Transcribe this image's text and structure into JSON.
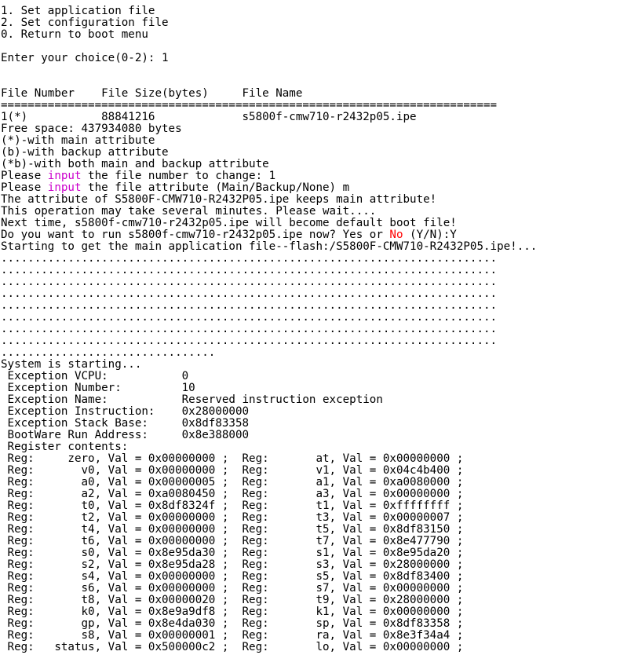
{
  "terminal": {
    "text_color": "#000000",
    "background_color": "#ffffff",
    "highlight_input_color": "#cc00cc",
    "highlight_no_color": "#ff0000",
    "lines": [
      {
        "segments": [
          {
            "text": "1. Set application file"
          }
        ]
      },
      {
        "segments": [
          {
            "text": "2. Set configuration file"
          }
        ]
      },
      {
        "segments": [
          {
            "text": "0. Return to boot menu"
          }
        ]
      },
      {
        "segments": [
          {
            "text": ""
          }
        ]
      },
      {
        "segments": [
          {
            "text": "Enter your choice(0-2): 1"
          }
        ]
      },
      {
        "segments": [
          {
            "text": ""
          }
        ]
      },
      {
        "segments": [
          {
            "text": ""
          }
        ]
      },
      {
        "segments": [
          {
            "text": "File Number    File Size(bytes)     File Name"
          }
        ]
      },
      {
        "segments": [
          {
            "text": "=========================================================================="
          }
        ]
      },
      {
        "segments": [
          {
            "text": "1(*)           88841216             s5800f-cmw710-r2432p05.ipe"
          }
        ]
      },
      {
        "segments": [
          {
            "text": "Free space: 437934080 bytes"
          }
        ]
      },
      {
        "segments": [
          {
            "text": "(*)-with main attribute"
          }
        ]
      },
      {
        "segments": [
          {
            "text": "(b)-with backup attribute"
          }
        ]
      },
      {
        "segments": [
          {
            "text": "(*b)-with both main and backup attribute"
          }
        ]
      },
      {
        "segments": [
          {
            "text": "Please "
          },
          {
            "text": "input",
            "style": "hl-input"
          },
          {
            "text": " the file number to change: 1"
          }
        ]
      },
      {
        "segments": [
          {
            "text": "Please "
          },
          {
            "text": "input",
            "style": "hl-input"
          },
          {
            "text": " the file attribute (Main/Backup/None) m"
          }
        ]
      },
      {
        "segments": [
          {
            "text": "The attribute of S5800F-CMW710-R2432P05.ipe keeps main attribute!"
          }
        ]
      },
      {
        "segments": [
          {
            "text": "This operation may take several minutes. Please wait...."
          }
        ]
      },
      {
        "segments": [
          {
            "text": "Next time, s5800f-cmw710-r2432p05.ipe will become default boot file!"
          }
        ]
      },
      {
        "segments": [
          {
            "text": "Do you want to run s5800f-cmw710-r2432p05.ipe now? Yes or "
          },
          {
            "text": "No",
            "style": "hl-no"
          },
          {
            "text": " (Y/N):Y"
          }
        ]
      },
      {
        "segments": [
          {
            "text": "Starting to get the main application file--flash:/S5800F-CMW710-R2432P05.ipe!..."
          }
        ]
      },
      {
        "segments": [
          {
            "text": ".........................................................................."
          }
        ]
      },
      {
        "segments": [
          {
            "text": ".........................................................................."
          }
        ]
      },
      {
        "segments": [
          {
            "text": ".........................................................................."
          }
        ]
      },
      {
        "segments": [
          {
            "text": ".........................................................................."
          }
        ]
      },
      {
        "segments": [
          {
            "text": ".........................................................................."
          }
        ]
      },
      {
        "segments": [
          {
            "text": ".........................................................................."
          }
        ]
      },
      {
        "segments": [
          {
            "text": ".........................................................................."
          }
        ]
      },
      {
        "segments": [
          {
            "text": ".........................................................................."
          }
        ]
      },
      {
        "segments": [
          {
            "text": "................................"
          }
        ]
      },
      {
        "segments": [
          {
            "text": "System is starting..."
          }
        ]
      },
      {
        "segments": [
          {
            "text": " Exception VCPU:           0"
          }
        ]
      },
      {
        "segments": [
          {
            "text": " Exception Number:         10"
          }
        ]
      },
      {
        "segments": [
          {
            "text": " Exception Name:           Reserved instruction exception"
          }
        ]
      },
      {
        "segments": [
          {
            "text": " Exception Instruction:    0x28000000"
          }
        ]
      },
      {
        "segments": [
          {
            "text": " Exception Stack Base:     0x8df83358"
          }
        ]
      },
      {
        "segments": [
          {
            "text": " BootWare Run Address:     0x8e388000"
          }
        ]
      },
      {
        "segments": [
          {
            "text": " Register contents:"
          }
        ]
      },
      {
        "segments": [
          {
            "text": " Reg:     zero, Val = 0x00000000 ;  Reg:       at, Val = 0x00000000 ;"
          }
        ]
      },
      {
        "segments": [
          {
            "text": " Reg:       v0, Val = 0x00000000 ;  Reg:       v1, Val = 0x04c4b400 ;"
          }
        ]
      },
      {
        "segments": [
          {
            "text": " Reg:       a0, Val = 0x00000005 ;  Reg:       a1, Val = 0xa0080000 ;"
          }
        ]
      },
      {
        "segments": [
          {
            "text": " Reg:       a2, Val = 0xa0080450 ;  Reg:       a3, Val = 0x00000000 ;"
          }
        ]
      },
      {
        "segments": [
          {
            "text": " Reg:       t0, Val = 0x8df8324f ;  Reg:       t1, Val = 0xffffffff ;"
          }
        ]
      },
      {
        "segments": [
          {
            "text": " Reg:       t2, Val = 0x00000000 ;  Reg:       t3, Val = 0x00000007 ;"
          }
        ]
      },
      {
        "segments": [
          {
            "text": " Reg:       t4, Val = 0x00000000 ;  Reg:       t5, Val = 0x8df83150 ;"
          }
        ]
      },
      {
        "segments": [
          {
            "text": " Reg:       t6, Val = 0x00000000 ;  Reg:       t7, Val = 0x8e477790 ;"
          }
        ]
      },
      {
        "segments": [
          {
            "text": " Reg:       s0, Val = 0x8e95da30 ;  Reg:       s1, Val = 0x8e95da20 ;"
          }
        ]
      },
      {
        "segments": [
          {
            "text": " Reg:       s2, Val = 0x8e95da28 ;  Reg:       s3, Val = 0x28000000 ;"
          }
        ]
      },
      {
        "segments": [
          {
            "text": " Reg:       s4, Val = 0x00000000 ;  Reg:       s5, Val = 0x8df83400 ;"
          }
        ]
      },
      {
        "segments": [
          {
            "text": " Reg:       s6, Val = 0x00000000 ;  Reg:       s7, Val = 0x00000000 ;"
          }
        ]
      },
      {
        "segments": [
          {
            "text": " Reg:       t8, Val = 0x00000020 ;  Reg:       t9, Val = 0x28000000 ;"
          }
        ]
      },
      {
        "segments": [
          {
            "text": " Reg:       k0, Val = 0x8e9a9df8 ;  Reg:       k1, Val = 0x00000000 ;"
          }
        ]
      },
      {
        "segments": [
          {
            "text": " Reg:       gp, Val = 0x8e4da030 ;  Reg:       sp, Val = 0x8df83358 ;"
          }
        ]
      },
      {
        "segments": [
          {
            "text": " Reg:       s8, Val = 0x00000001 ;  Reg:       ra, Val = 0x8e3f34a4 ;"
          }
        ]
      },
      {
        "segments": [
          {
            "text": " Reg:   status, Val = 0x500000c2 ;  Reg:       lo, Val = 0x00000000 ;"
          }
        ]
      }
    ]
  }
}
